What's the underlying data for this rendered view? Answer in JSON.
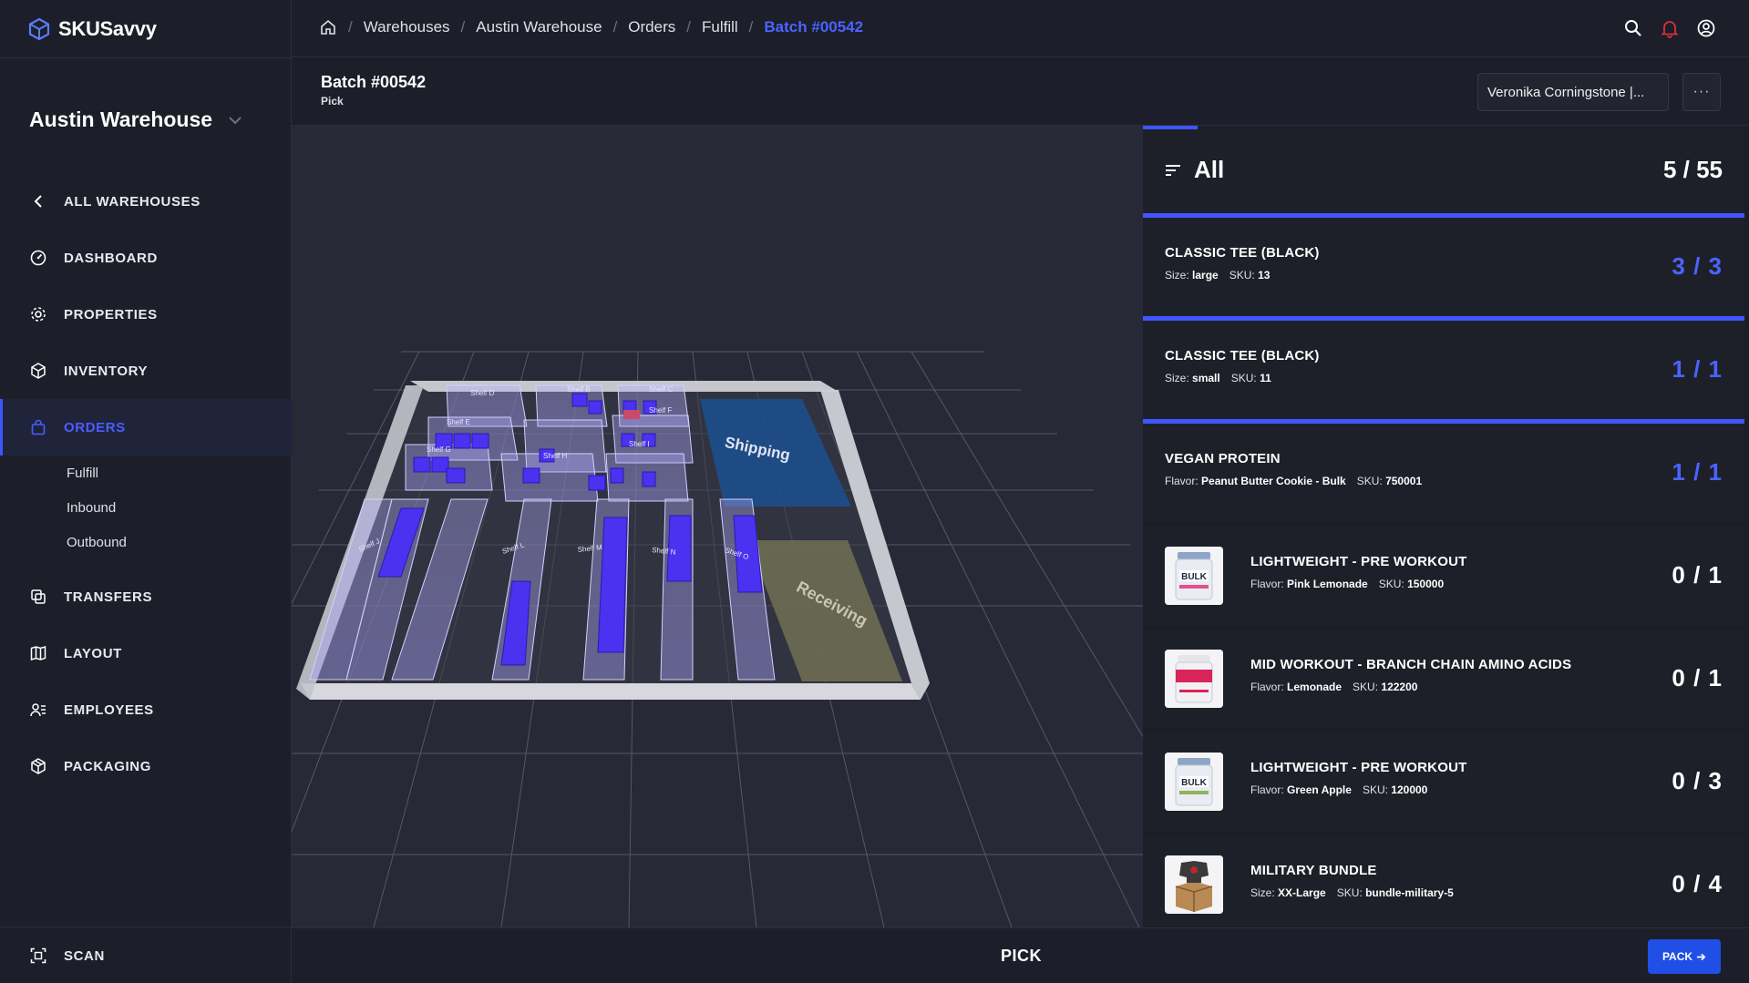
{
  "app": {
    "name": "SKUSavvy"
  },
  "sidebar": {
    "warehouse_name": "Austin Warehouse",
    "back_label": "ALL WAREHOUSES",
    "items": [
      {
        "label": "DASHBOARD",
        "icon": "dashboard-icon"
      },
      {
        "label": "PROPERTIES",
        "icon": "gear-icon"
      },
      {
        "label": "INVENTORY",
        "icon": "box-icon"
      },
      {
        "label": "ORDERS",
        "icon": "bag-icon",
        "active": true
      },
      {
        "label": "TRANSFERS",
        "icon": "transfer-icon"
      },
      {
        "label": "LAYOUT",
        "icon": "map-icon"
      },
      {
        "label": "EMPLOYEES",
        "icon": "people-icon"
      },
      {
        "label": "PACKAGING",
        "icon": "package-icon"
      }
    ],
    "sub_items": [
      "Fulfill",
      "Inbound",
      "Outbound"
    ],
    "scan_label": "SCAN"
  },
  "breadcrumb": {
    "items": [
      "Warehouses",
      "Austin Warehouse",
      "Orders",
      "Fulfill"
    ],
    "current": "Batch #00542"
  },
  "header": {
    "title": "Batch #00542",
    "subtitle": "Pick",
    "assignee": "Veronika Corningstone |...",
    "more_label": "···"
  },
  "map": {
    "zone_shipping": "Shipping",
    "zone_receiving": "Receiving",
    "shelf_labels": [
      "Shelf B",
      "Shelf C",
      "Shelf D",
      "Shelf E",
      "Shelf F",
      "Shelf G",
      "Shelf H",
      "Shelf I",
      "Shelf J",
      "Shelf L",
      "Shelf M",
      "Shelf N",
      "Shelf O"
    ]
  },
  "panel": {
    "filter_label": "All",
    "progress": "5 / 55",
    "items": [
      {
        "name": "CLASSIC TEE (BLACK)",
        "attr_label": "Size:",
        "attr_value": "large",
        "sku": "13",
        "qty": "3 / 3",
        "complete": true
      },
      {
        "name": "CLASSIC TEE (BLACK)",
        "attr_label": "Size:",
        "attr_value": "small",
        "sku": "11",
        "qty": "1 / 1",
        "complete": true
      },
      {
        "name": "VEGAN PROTEIN",
        "attr_label": "Flavor:",
        "attr_value": "Peanut Butter Cookie - Bulk",
        "sku": "750001",
        "qty": "1 / 1",
        "complete": true
      },
      {
        "name": "LIGHTWEIGHT - PRE WORKOUT",
        "attr_label": "Flavor:",
        "attr_value": "Pink Lemonade",
        "sku": "150000",
        "qty": "0 / 1",
        "complete": false,
        "thumb": "bulk-tub"
      },
      {
        "name": "MID WORKOUT - BRANCH CHAIN AMINO ACIDS",
        "attr_label": "Flavor:",
        "attr_value": "Lemonade",
        "sku": "122200",
        "qty": "0 / 1",
        "complete": false,
        "thumb": "lean-tub"
      },
      {
        "name": "LIGHTWEIGHT - PRE WORKOUT",
        "attr_label": "Flavor:",
        "attr_value": "Green Apple",
        "sku": "120000",
        "qty": "0 / 3",
        "complete": false,
        "thumb": "bulk-tub"
      },
      {
        "name": "MILITARY BUNDLE",
        "attr_label": "Size:",
        "attr_value": "XX-Large",
        "sku": "bundle-military-5",
        "qty": "0 / 4",
        "complete": false,
        "thumb": "bundle-box"
      }
    ]
  },
  "thumb_text": {
    "bulk": "BULK"
  },
  "sku_label": "SKU:",
  "footer": {
    "mode": "PICK",
    "pack_label": "PACK"
  },
  "colors": {
    "accent": "#3f56ff",
    "shelf_item": "#4a32f0",
    "shipping_zone": "#1e4e8c",
    "receiving_zone": "#6e6c52"
  }
}
